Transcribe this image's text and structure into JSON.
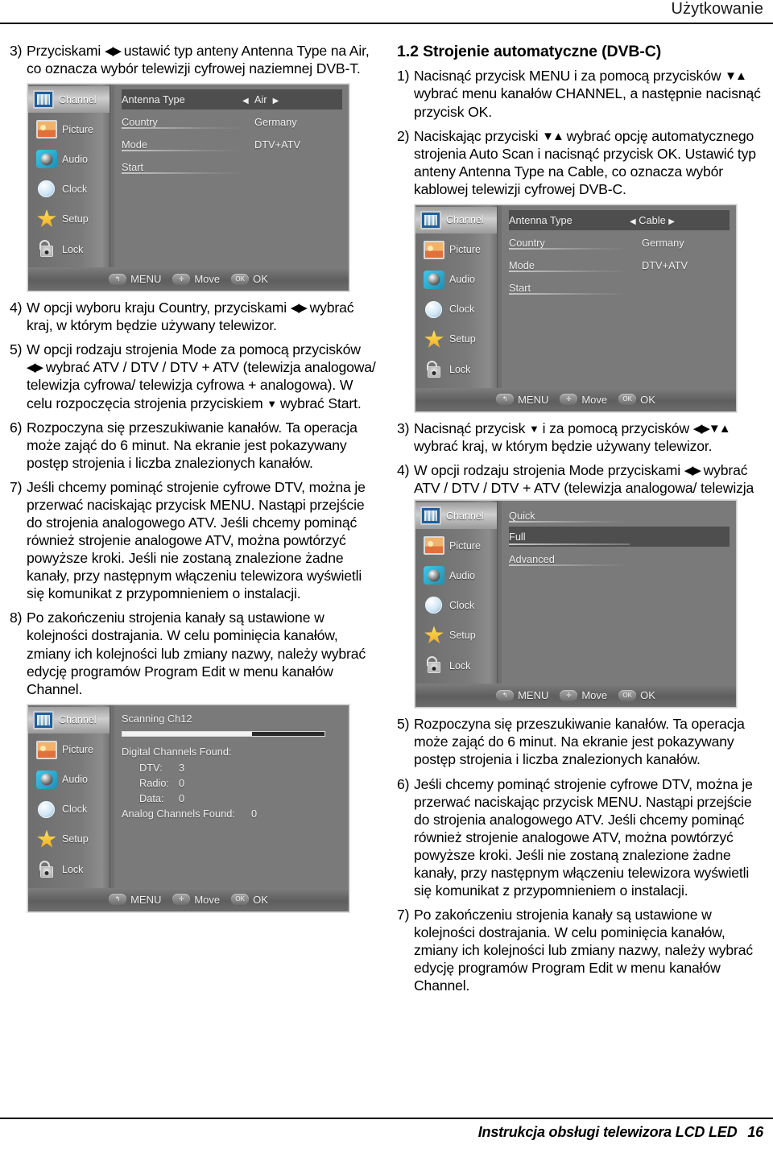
{
  "header": {
    "title": "Użytkowanie"
  },
  "footer": {
    "text": "Instrukcja obsługi telewizora LCD LED",
    "page": "16"
  },
  "left_column": {
    "item3": {
      "num": "3)",
      "text_a": "Przyciskami ",
      "glyph": "◀▶",
      "text_b": " ustawić  typ anteny Antenna Type na Air, co oznacza wybór telewizji cyfrowej naziemnej DVB-T."
    },
    "item4": {
      "num": "4)",
      "text_a": "W opcji wyboru kraju Country, przyciskami ",
      "glyph": "◀▶",
      "text_b": " wybrać kraj, w którym będzie używany telewizor."
    },
    "item5": {
      "num": "5)",
      "text_a": "W opcji rodzaju strojenia Mode za pomocą przycisków ",
      "glyph": "◀▶",
      "text_b": " wybrać ATV / DTV / DTV + ATV (telewizja analogowa/ telewizja cyfrowa/ telewizja cyfrowa + analogowa). W celu rozpoczęcia strojenia przyciskiem ",
      "glyph2": "▼",
      "text_c": " wybrać Start."
    },
    "item6": {
      "num": "6)",
      "text": "Rozpoczyna się przeszukiwanie kanałów. Ta operacja może zająć do 6 minut.  Na ekranie jest pokazywany postęp strojenia i liczba znalezionych kanałów."
    },
    "item7": {
      "num": "7)",
      "text": "Jeśli chcemy pominąć strojenie cyfrowe DTV, można je przerwać naciskając przycisk MENU. Nastąpi przejście do strojenia analogowego ATV. Jeśli chcemy pominąć również strojenie analogowe ATV, można powtórzyć powyższe kroki. Jeśli nie zostaną znalezione żadne kanały, przy następnym włączeniu telewizora wyświetli się komunikat z przypomnieniem o instalacji."
    },
    "item8": {
      "num": "8)",
      "text": "Po zakończeniu strojenia kanały są ustawione w kolejności dostrajania. W celu pominięcia kanałów, zmiany ich kolejności lub zmiany nazwy, należy wybrać edycję programów Program Edit w menu kanałów Channel."
    }
  },
  "right_column": {
    "section_title": "1.2 Strojenie automatyczne (DVB-C)",
    "item1": {
      "num": "1)",
      "text_a": "Nacisnąć przycisk MENU i za pomocą przycisków ",
      "glyph": "▼▲",
      "text_b": " wybrać menu kanałów CHANNEL, a następnie nacisnąć przycisk OK."
    },
    "item2": {
      "num": "2)",
      "text_a": "Naciskając przyciski ",
      "glyph": "▼▲",
      "text_b": " wybrać opcję automatycznego strojenia Auto Scan i nacisnąć przycisk OK. Ustawić  typ anteny Antenna Type na Cable, co oznacza wybór kablowej telewizji cyfrowej DVB-C."
    },
    "item3": {
      "num": "3)",
      "text_a": "Nacisnąć przycisk ",
      "glyph": "▼",
      "text_b": " i za pomocą przycisków ",
      "glyph2": "◀▶▼▲",
      "text_c": " wybrać kraj, w którym będzie używany telewizor."
    },
    "item4": {
      "num": "4)",
      "text_a": "W opcji rodzaju strojenia Mode przyciskami ",
      "glyph": "◀▶",
      "text_b": " wybrać ATV / DTV / DTV + ATV (telewizja analogowa/ telewizja cyfrowa/ telewizja cyfrowa + analogowa)."
    },
    "item5": {
      "num": "5)",
      "text": "Rozpoczyna się przeszukiwanie kanałów. Ta operacja może zająć do 6 minut.  Na ekranie jest pokazywany postęp strojenia i liczba znalezionych kanałów."
    },
    "item6": {
      "num": "6)",
      "text": "Jeśli chcemy pominąć strojenie cyfrowe DTV, można je przerwać naciskając przycisk MENU. Nastąpi przejście do strojenia analogowego ATV. Jeśli chcemy pominąć również strojenie analogowe ATV, można powtórzyć powyższe kroki. Jeśli nie zostaną znalezione żadne kanały, przy następnym włączeniu telewizora wyświetli się komunikat z przypomnieniem o instalacji."
    },
    "item7": {
      "num": "7)",
      "text": "Po zakończeniu strojenia kanały są ustawione w kolejności dostrajania. W celu pominięcia kanałów, zmiany ich kolejności lub zmiany nazwy, należy wybrać edycję programów Program Edit w menu kanałów Channel."
    }
  },
  "osd_common": {
    "sidebar": [
      {
        "label": "Channel",
        "icon": "channel-icon"
      },
      {
        "label": "Picture",
        "icon": "picture-icon"
      },
      {
        "label": "Audio",
        "icon": "audio-icon"
      },
      {
        "label": "Clock",
        "icon": "clock-icon"
      },
      {
        "label": "Setup",
        "icon": "setup-star-icon"
      },
      {
        "label": "Lock",
        "icon": "lock-padlock-icon"
      }
    ],
    "footer_buttons": [
      {
        "key": "↰",
        "label": "MENU"
      },
      {
        "key": "✛",
        "label": "Move"
      },
      {
        "key": "OK",
        "label": "OK"
      }
    ],
    "colors": {
      "panel_bg": "#7a7a7a",
      "sidebar_bg": "#6f6f6f",
      "highlight_row": "#4e4e4e",
      "text": "#efefef",
      "progress_fill": "#f2f2f2",
      "progress_track": "#2b2b2b"
    }
  },
  "osd_air": {
    "rows": [
      {
        "label": "Antenna Type",
        "value": "Air",
        "arrows": true,
        "highlighted": true
      },
      {
        "label": "Country",
        "value": "Germany",
        "arrows": false,
        "highlighted": false
      },
      {
        "label": "Mode",
        "value": "DTV+ATV",
        "arrows": false,
        "highlighted": false
      },
      {
        "label": "Start",
        "value": "",
        "arrows": false,
        "highlighted": false
      }
    ],
    "arrow_left": "◀",
    "arrow_right": "▶"
  },
  "osd_cable": {
    "rows": [
      {
        "label": "Antenna Type",
        "value": "Cable",
        "arrows": true,
        "highlighted": true
      },
      {
        "label": "Country",
        "value": "Germany",
        "arrows": false,
        "highlighted": false
      },
      {
        "label": "Mode",
        "value": "DTV+ATV",
        "arrows": false,
        "highlighted": false
      },
      {
        "label": "Start",
        "value": "",
        "arrows": false,
        "highlighted": false
      }
    ],
    "arrow_left": "◀",
    "arrow_right": "▶"
  },
  "osd_scanmode": {
    "rows": [
      {
        "label": "Quick",
        "highlighted": false
      },
      {
        "label": "Full",
        "highlighted": true
      },
      {
        "label": "Advanced",
        "highlighted": false
      }
    ]
  },
  "osd_scanning": {
    "title": "Scanning Ch12",
    "progress_percent": 64,
    "digital_header": "Digital Channels Found:",
    "digital": [
      {
        "label": "DTV:",
        "value": "3"
      },
      {
        "label": "Radio:",
        "value": "0"
      },
      {
        "label": "Data:",
        "value": "0"
      }
    ],
    "analog_label": "Analog Channels Found:",
    "analog_value": "0"
  }
}
